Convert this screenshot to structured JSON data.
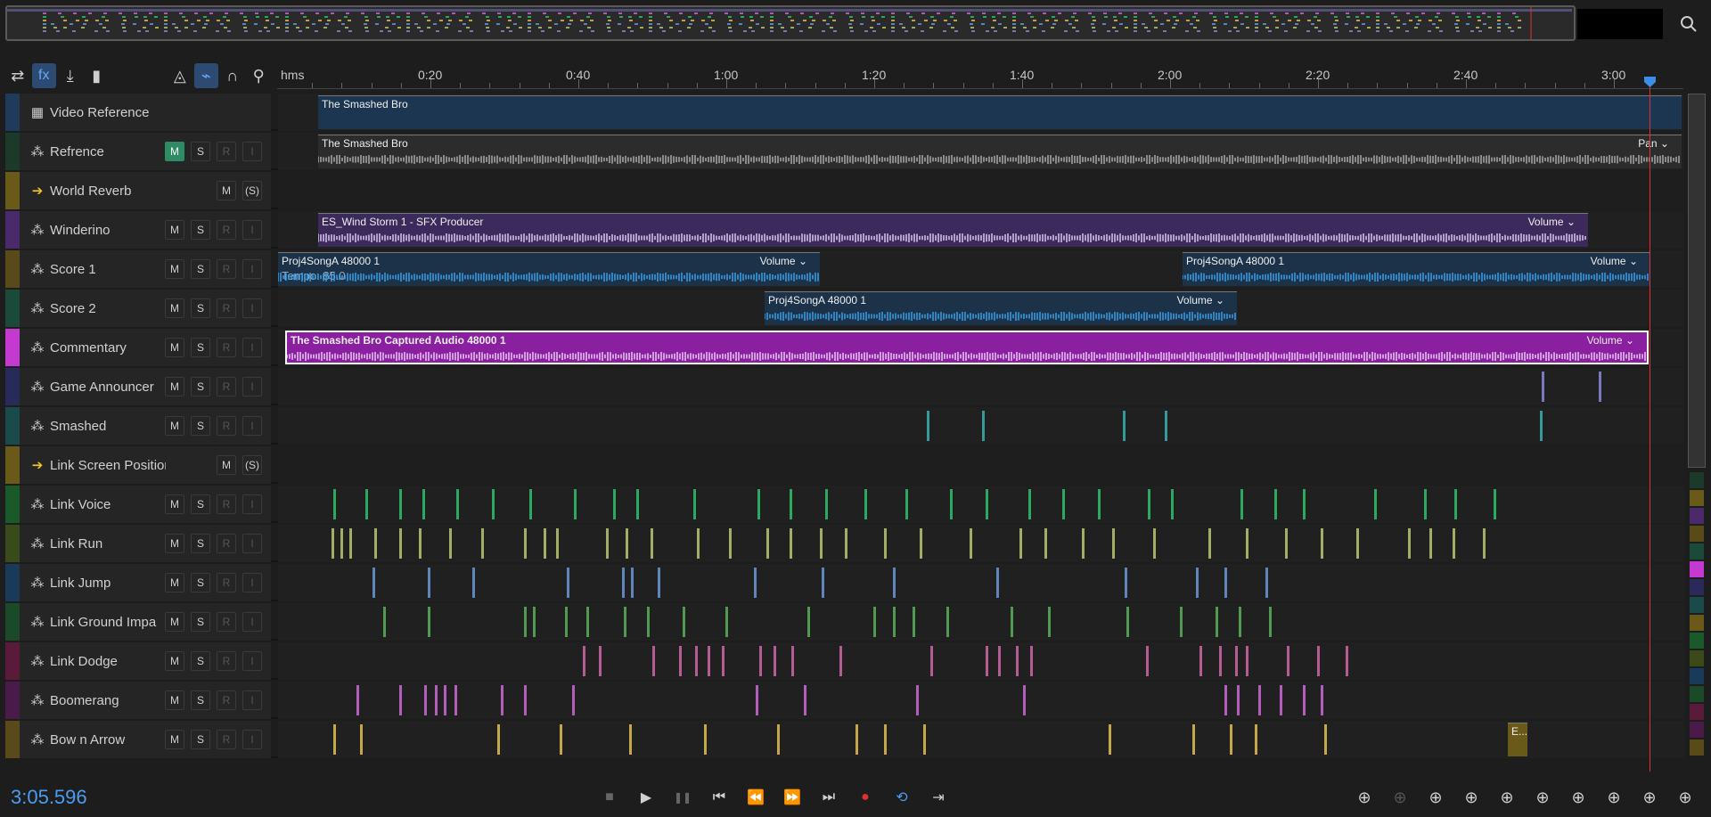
{
  "ruler": {
    "unit_label": "hms",
    "ticks": [
      "0:20",
      "0:40",
      "1:00",
      "1:20",
      "1:40",
      "2:00",
      "2:20",
      "2:40",
      "3:00"
    ]
  },
  "toolbar": {
    "icons": [
      "switch-icon",
      "fx-icon",
      "cursor-icon",
      "levels-icon",
      "metronome-icon",
      "snap-icon",
      "headphones-icon",
      "marker-icon"
    ]
  },
  "tracks": [
    {
      "name": "Video Reference",
      "type": "video",
      "color": "#1f3a5a",
      "clips": [
        {
          "name": "The Smashed Bro",
          "label": ""
        }
      ]
    },
    {
      "name": "Refrence",
      "type": "audio",
      "color": "#1c3a2a",
      "mute_on": true,
      "clips": [
        {
          "name": "The Smashed Bro",
          "label": "Pan"
        }
      ]
    },
    {
      "name": "World Reverb",
      "type": "bus",
      "color": "#6a5a1a",
      "clips": []
    },
    {
      "name": "Winderino",
      "type": "audio",
      "color": "#4a2a6a",
      "clips": [
        {
          "name": "ES_Wind Storm 1 - SFX Producer",
          "label": "Volume"
        }
      ]
    },
    {
      "name": "Score 1",
      "type": "audio",
      "color": "#5a4a1a",
      "clips": [
        {
          "name": "Proj4SongA 48000 1",
          "label": "Volume",
          "overlay": "Tempo: 85.0"
        },
        {
          "name": "Proj4SongA 48000 1",
          "label": "Volume"
        }
      ]
    },
    {
      "name": "Score 2",
      "type": "audio",
      "color": "#1a4a3a",
      "clips": [
        {
          "name": "Proj4SongA 48000 1",
          "label": "Volume"
        }
      ]
    },
    {
      "name": "Commentary",
      "type": "audio",
      "color": "#c43ad0",
      "clips": [
        {
          "name": "The Smashed Bro Captured Audio 48000 1",
          "label": "Volume"
        }
      ]
    },
    {
      "name": "Game Announcer",
      "type": "audio",
      "color": "#2a2a5a",
      "clips": []
    },
    {
      "name": "Smashed",
      "type": "audio",
      "color": "#1a4a4a",
      "clips": []
    },
    {
      "name": "Link Screen Position",
      "type": "bus",
      "color": "#6a5a1a",
      "clips": []
    },
    {
      "name": "Link Voice",
      "type": "audio",
      "color": "#1a5a2a",
      "clips": []
    },
    {
      "name": "Link Run",
      "type": "audio",
      "color": "#3a4a1a",
      "clips": []
    },
    {
      "name": "Link Jump",
      "type": "audio",
      "color": "#1a3a5a",
      "clips": []
    },
    {
      "name": "Link Ground Impa",
      "type": "audio",
      "color": "#1a4a2a",
      "clips": []
    },
    {
      "name": "Link Dodge",
      "type": "audio",
      "color": "#5a1a3a",
      "clips": []
    },
    {
      "name": "Boomerang",
      "type": "audio",
      "color": "#4a1a4a",
      "clips": []
    },
    {
      "name": "Bow n Arrow",
      "type": "audio",
      "color": "#5a4a1a",
      "clips": [
        {
          "name": "E...",
          "label": ""
        }
      ]
    }
  ],
  "buttons": {
    "mute": "M",
    "solo": "S",
    "record": "R",
    "input": "I",
    "solo_safe": "(S)"
  },
  "transport": {
    "timecode": "3:05.596",
    "controls": [
      "stop-icon",
      "play-icon",
      "pause-icon",
      "go-to-start-icon",
      "rewind-icon",
      "fast-forward-icon",
      "go-to-end-icon",
      "record-icon",
      "loop-icon",
      "skip-icon"
    ]
  },
  "zoom_controls": [
    "zoom-in-amplitude-icon",
    "zoom-out-amplitude-icon",
    "zoom-in-time-icon",
    "zoom-out-time-icon",
    "zoom-selection-icon",
    "zoom-in-point-icon",
    "zoom-out-point-icon",
    "zoom-full-icon",
    "zoom-tracks-icon",
    "zoom-session-icon"
  ],
  "colors": {
    "accent": "#4a9ef0",
    "playhead": "#dd3333",
    "mute_on": "#2d8c63"
  }
}
